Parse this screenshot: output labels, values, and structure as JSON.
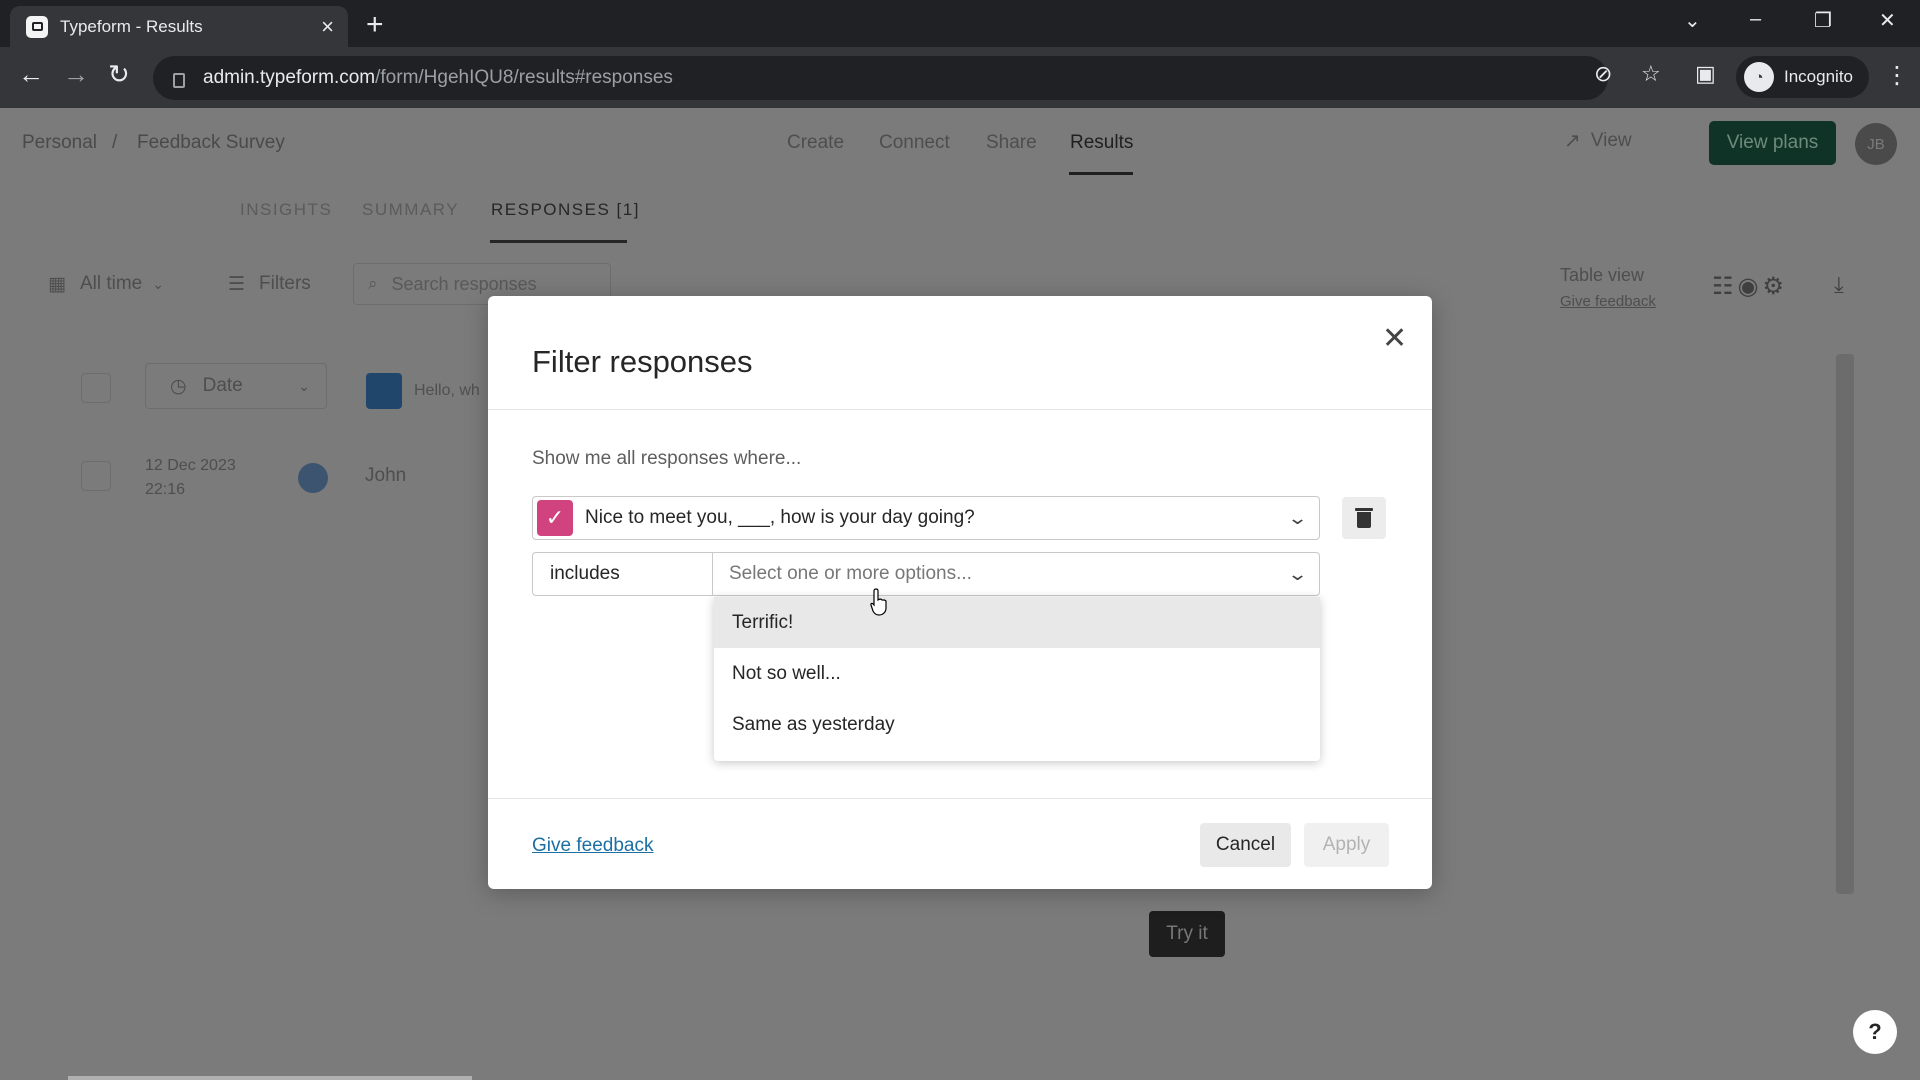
{
  "browser": {
    "tab_title": "Typeform - Results",
    "new_tab": "+",
    "url_host": "admin.typeform.com",
    "url_path": "/form/HgehIQU8/results#responses",
    "incognito_label": "Incognito"
  },
  "header": {
    "breadcrumb": [
      "Personal",
      "/",
      "Feedback Survey"
    ],
    "nav": [
      "Create",
      "Connect",
      "Share",
      "Results"
    ],
    "active_nav": "Results",
    "view_label": "View",
    "plans_label": "View plans",
    "avatar_initials": "JB"
  },
  "subtabs": [
    "INSIGHTS",
    "SUMMARY",
    "RESPONSES [1]"
  ],
  "toolbar": {
    "time_filter": "All time",
    "filters_label": "Filters",
    "search_placeholder": "Search responses",
    "table_view_label": "Table view",
    "table_view_feedback": "Give feedback"
  },
  "grid": {
    "date_column": "Date",
    "question_column": "Hello, wh",
    "rows": [
      {
        "date": "12 Dec 2023",
        "time": "22:16",
        "name": "John"
      }
    ],
    "try_it_label": "Try it"
  },
  "help_label": "?",
  "modal": {
    "title": "Filter responses",
    "lead": "Show me all responses where...",
    "question": "Nice to meet you, ___, how is your day going?",
    "operator": "includes",
    "options_placeholder": "Select one or more options...",
    "options": [
      "Terrific!",
      "Not so well...",
      "Same as yesterday"
    ],
    "feedback_link": "Give feedback",
    "cancel_label": "Cancel",
    "apply_label": "Apply"
  },
  "colors": {
    "question_badge": "#d1437f",
    "plans_button": "#0f3326",
    "link": "#1c6fa3"
  }
}
